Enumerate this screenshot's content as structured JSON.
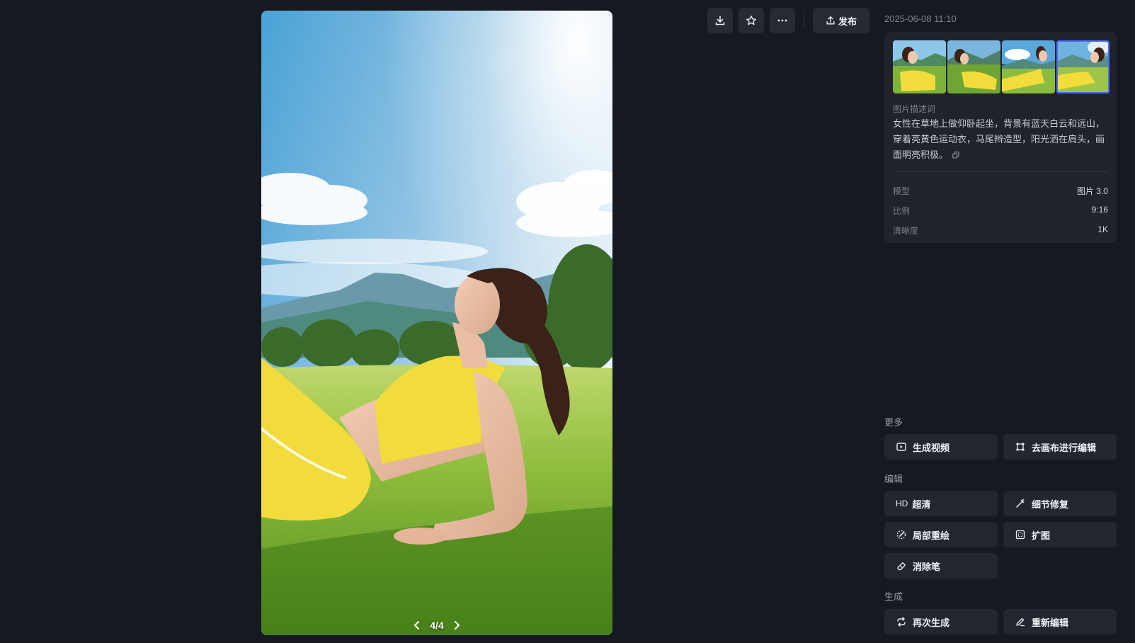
{
  "toolbar": {
    "download": "download-icon",
    "favorite": "star-icon",
    "more": "more-icon",
    "publish_label": "发布"
  },
  "viewer": {
    "pager_text": "4/4"
  },
  "panel": {
    "timestamp": "2025-06-08 11:10",
    "prompt_label": "图片描述词",
    "prompt_text": "女性在草地上做仰卧起坐，背景有蓝天白云和远山，穿着亮黄色运动衣，马尾辫造型，阳光洒在肩头，画面明亮积极。",
    "meta": [
      {
        "key": "模型",
        "value": "图片 3.0"
      },
      {
        "key": "比例",
        "value": "9:16"
      },
      {
        "key": "清晰度",
        "value": "1K"
      }
    ]
  },
  "sections": {
    "more": "更多",
    "edit": "编辑",
    "generate": "生成"
  },
  "actions": {
    "gen_video": "生成视频",
    "canvas_edit": "去画布进行编辑",
    "hd_badge": "HD",
    "upscale": "超清",
    "detail_fix": "细节修复",
    "inpaint": "局部重绘",
    "expand": "扩图",
    "eraser": "消除笔",
    "regenerate": "再次生成",
    "reedit": "重新编辑"
  },
  "colors": {
    "background": "#161920",
    "card": "#20232b",
    "button": "#23262e",
    "outfit_yellow": "#f1dc3c"
  }
}
